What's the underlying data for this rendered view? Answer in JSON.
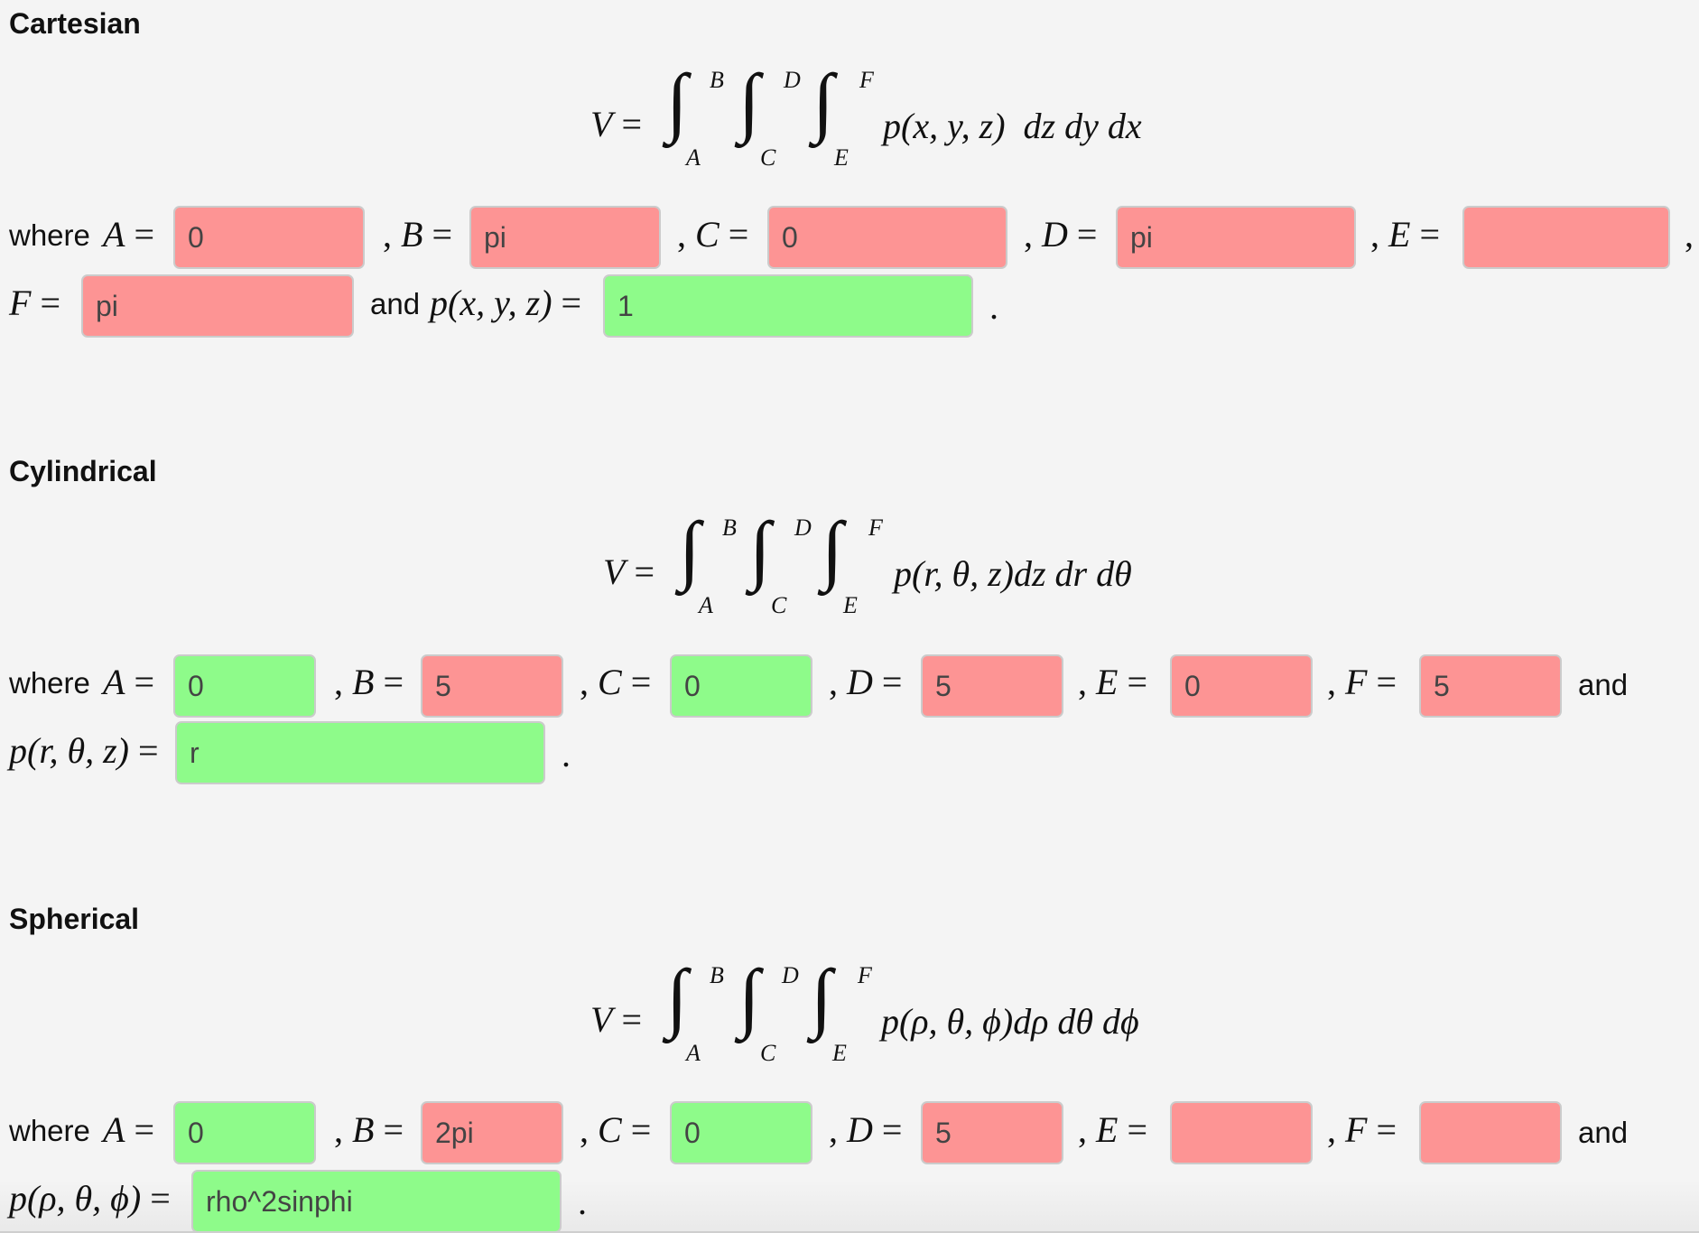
{
  "sections": {
    "cartesian": {
      "title": "Cartesian",
      "formula": {
        "lhs": "V",
        "eq": "=",
        "limits": {
          "B": "B",
          "A": "A",
          "D": "D",
          "C": "C",
          "F": "F",
          "E": "E"
        },
        "integrand": "p(x, y, z)  dz dy dx"
      },
      "labels": {
        "where": "where",
        "A": "A",
        "B": "B",
        "C": "C",
        "D": "D",
        "E": "E",
        "F": "F",
        "eq": "=",
        "comma": ",",
        "and": "and",
        "p": "p(x, y, z)",
        "period": "."
      },
      "fields": {
        "A": {
          "value": "0",
          "status": "incorrect"
        },
        "B": {
          "value": "pi",
          "status": "incorrect"
        },
        "C": {
          "value": "0",
          "status": "incorrect"
        },
        "D": {
          "value": "pi",
          "status": "incorrect"
        },
        "E": {
          "value": "",
          "status": "incorrect"
        },
        "F": {
          "value": "pi",
          "status": "incorrect"
        },
        "p": {
          "value": "1",
          "status": "correct"
        }
      }
    },
    "cylindrical": {
      "title": "Cylindrical",
      "formula": {
        "lhs": "V",
        "eq": "=",
        "limits": {
          "B": "B",
          "A": "A",
          "D": "D",
          "C": "C",
          "F": "F",
          "E": "E"
        },
        "integrand": "p(r, θ, z)dz dr dθ"
      },
      "labels": {
        "where": "where",
        "A": "A",
        "B": "B",
        "C": "C",
        "D": "D",
        "E": "E",
        "F": "F",
        "eq": "=",
        "comma": ",",
        "and": "and",
        "p": "p(r, θ, z)",
        "period": "."
      },
      "fields": {
        "A": {
          "value": "0",
          "status": "correct"
        },
        "B": {
          "value": "5",
          "status": "incorrect"
        },
        "C": {
          "value": "0",
          "status": "correct"
        },
        "D": {
          "value": "5",
          "status": "incorrect"
        },
        "E": {
          "value": "0",
          "status": "incorrect"
        },
        "F": {
          "value": "5",
          "status": "incorrect"
        },
        "p": {
          "value": "r",
          "status": "correct"
        }
      }
    },
    "spherical": {
      "title": "Spherical",
      "formula": {
        "lhs": "V",
        "eq": "=",
        "limits": {
          "B": "B",
          "A": "A",
          "D": "D",
          "C": "C",
          "F": "F",
          "E": "E"
        },
        "integrand": "p(ρ, θ, ϕ)dρ dθ dϕ"
      },
      "labels": {
        "where": "where",
        "A": "A",
        "B": "B",
        "C": "C",
        "D": "D",
        "E": "E",
        "F": "F",
        "eq": "=",
        "comma": ",",
        "and": "and",
        "p": "p(ρ, θ, ϕ)",
        "period": "."
      },
      "fields": {
        "A": {
          "value": "0",
          "status": "correct"
        },
        "B": {
          "value": "2pi",
          "status": "incorrect"
        },
        "C": {
          "value": "0",
          "status": "correct"
        },
        "D": {
          "value": "5",
          "status": "incorrect"
        },
        "E": {
          "value": "",
          "status": "incorrect"
        },
        "F": {
          "value": "",
          "status": "incorrect"
        },
        "p": {
          "value": "rho^2sinphi",
          "status": "correct"
        }
      }
    }
  },
  "colors": {
    "incorrect": "#fd9494",
    "correct": "#8efb8a",
    "background": "#f4f4f4"
  }
}
